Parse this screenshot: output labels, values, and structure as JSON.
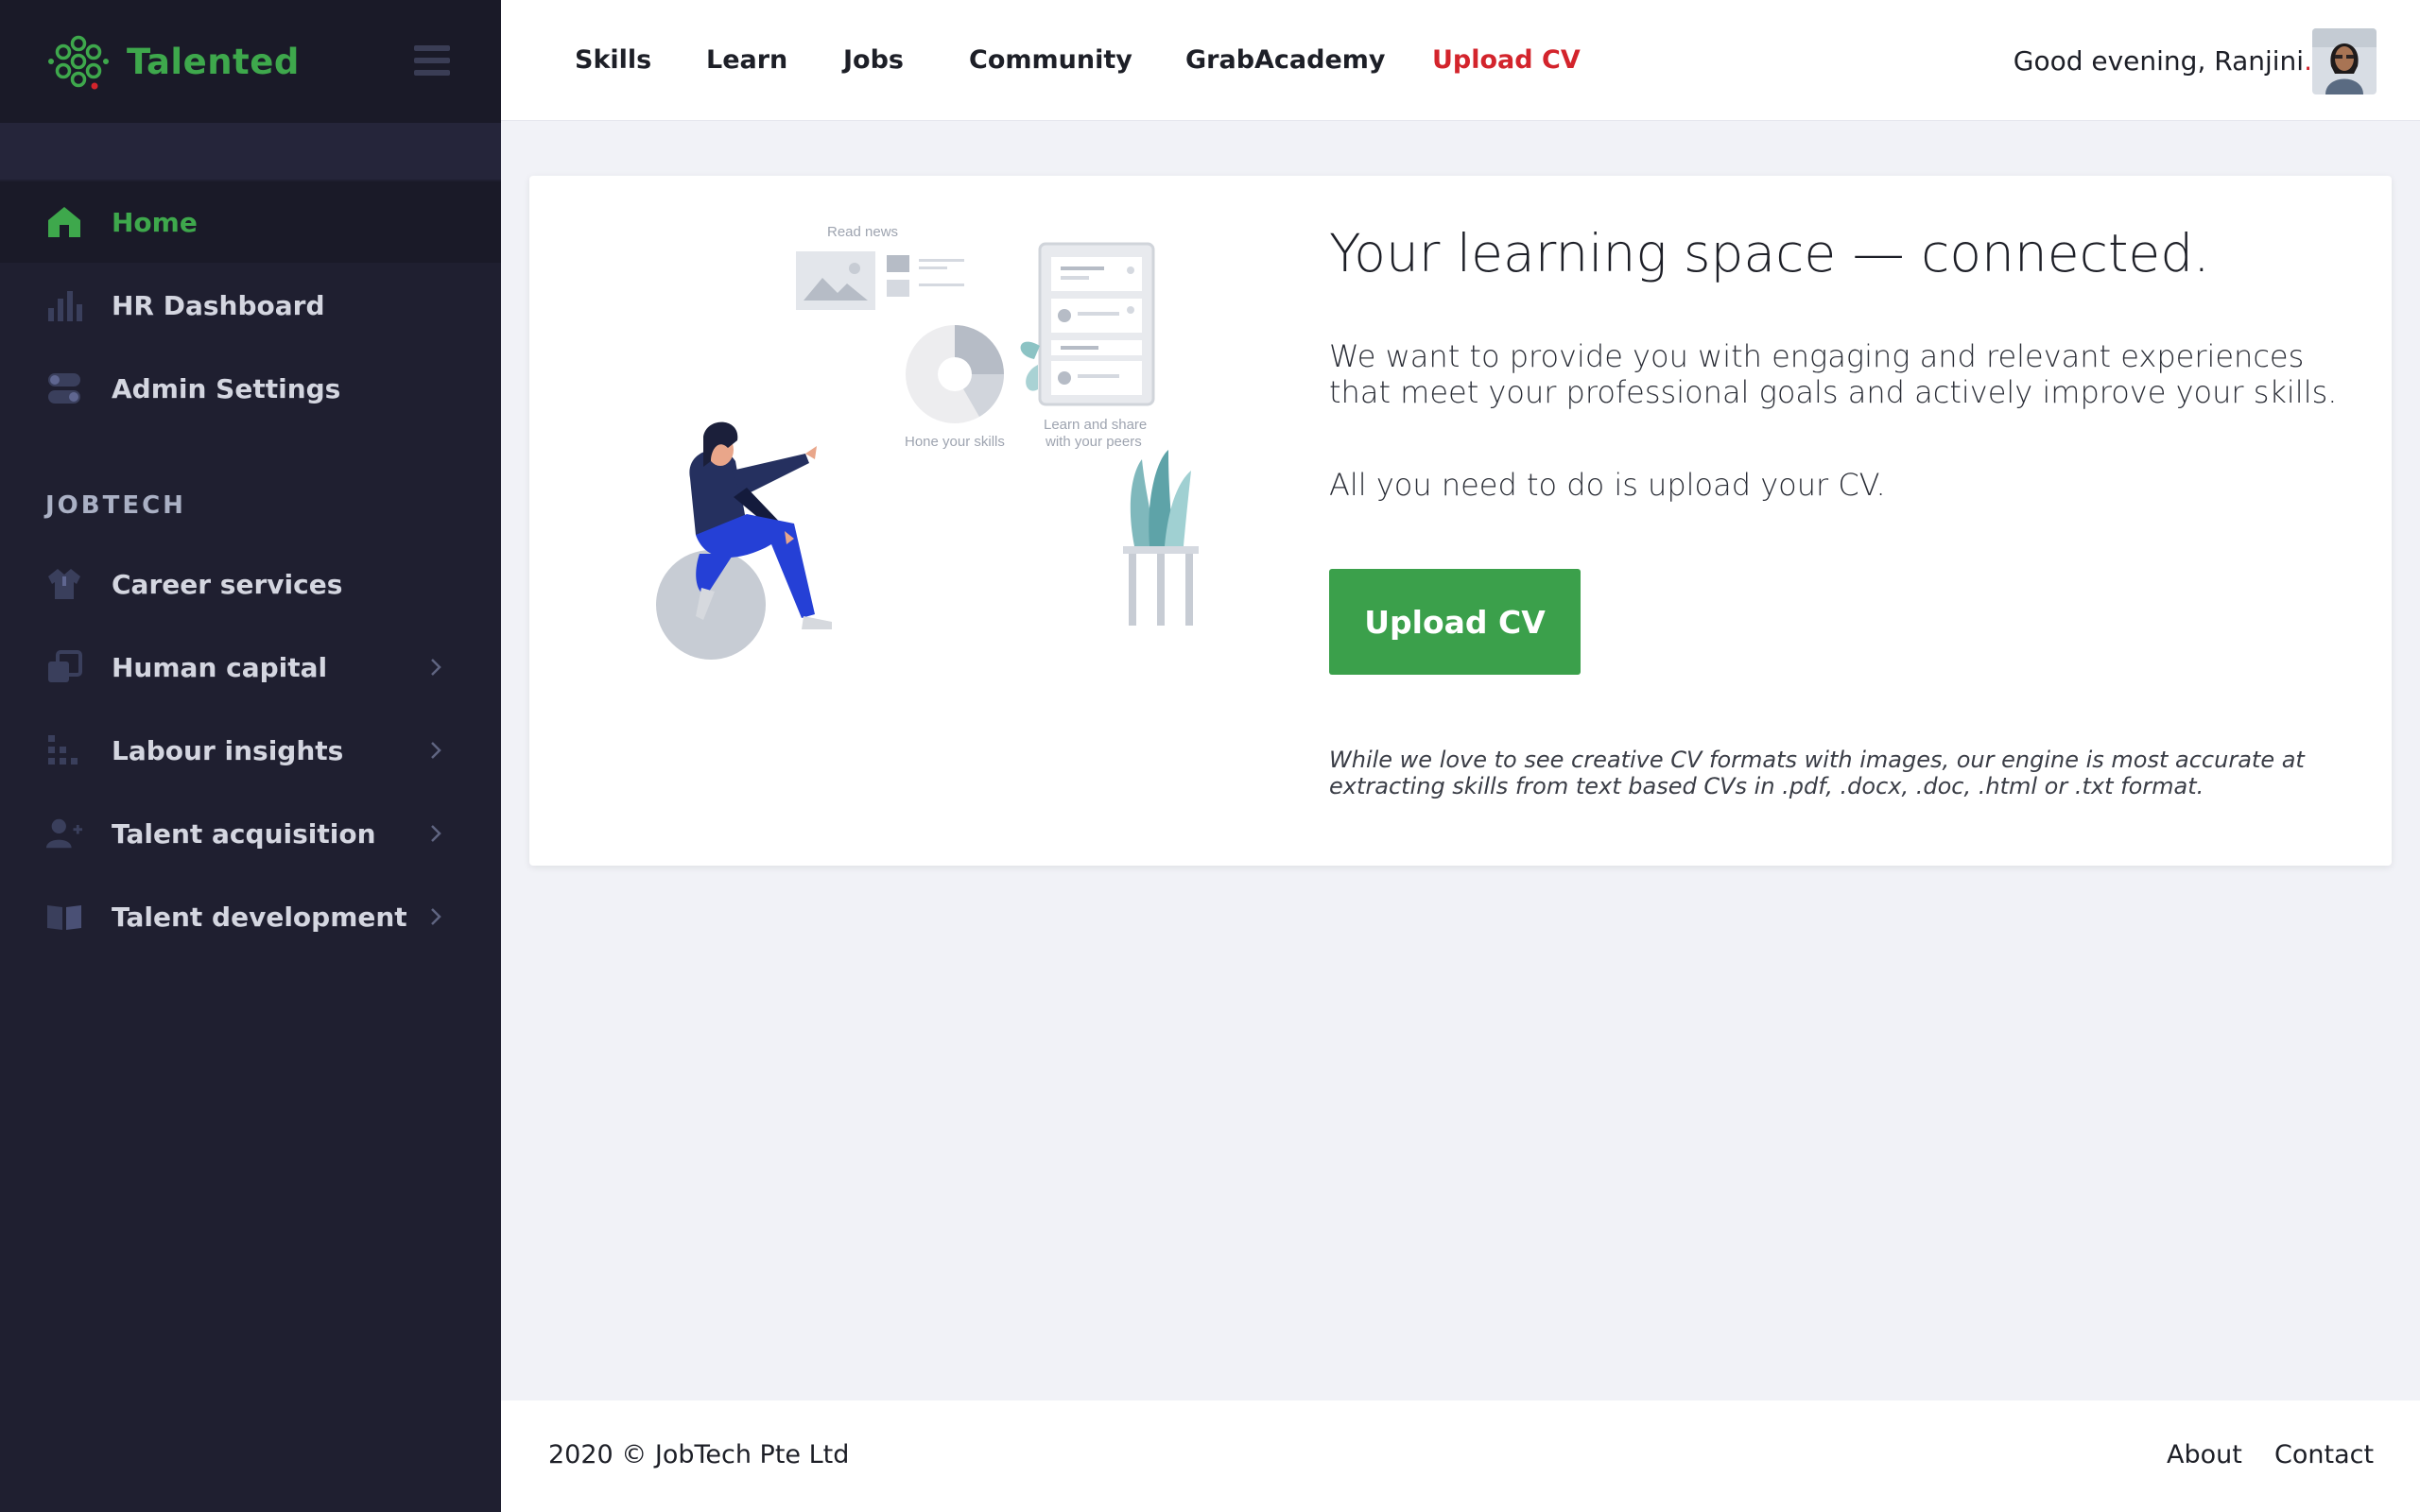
{
  "brand": {
    "name": "Talented",
    "logo_icon": "hexagon-cluster-logo",
    "accent": "#3ea84c"
  },
  "sidebar": {
    "items": [
      {
        "label": "Home",
        "icon": "home-icon",
        "active": true
      },
      {
        "label": "HR Dashboard",
        "icon": "bar-chart-icon"
      },
      {
        "label": "Admin Settings",
        "icon": "toggle-settings-icon"
      }
    ],
    "section_title": "JOBTECH",
    "jobtech_items": [
      {
        "label": "Career services",
        "icon": "shirt-icon"
      },
      {
        "label": "Human capital",
        "icon": "copy-icon",
        "expandable": true
      },
      {
        "label": "Labour insights",
        "icon": "dot-grid-icon",
        "expandable": true
      },
      {
        "label": "Talent acquisition",
        "icon": "add-user-icon",
        "expandable": true
      },
      {
        "label": "Talent development",
        "icon": "book-icon",
        "expandable": true
      }
    ]
  },
  "topnav": {
    "items": [
      "Skills",
      "Learn",
      "Jobs",
      "Community",
      "GrabAcademy",
      "Upload CV"
    ],
    "greeting": "Good evening,  Ranjini",
    "greeting_dot": ".",
    "highlight_color": "#d3242c"
  },
  "card": {
    "title": "Your learning space — connected.",
    "paragraph1": "We want to provide you with engaging and relevant experiences that meet your professional goals and actively improve your skills.",
    "paragraph2": "All you need to do is upload your CV.",
    "button_label": "Upload CV",
    "note": "While we love to see creative CV formats with images, our engine is most accurate at extracting skills from text based CVs in .pdf, .docx, .doc, .html or .txt format.",
    "illustration": {
      "read_news": "Read news",
      "hone_skills": "Hone your skills",
      "learn_share_1": "Learn and share",
      "learn_share_2": "with your peers"
    }
  },
  "footer": {
    "copyright": "2020 © JobTech Pte Ltd",
    "links": [
      "About",
      "Contact"
    ]
  }
}
